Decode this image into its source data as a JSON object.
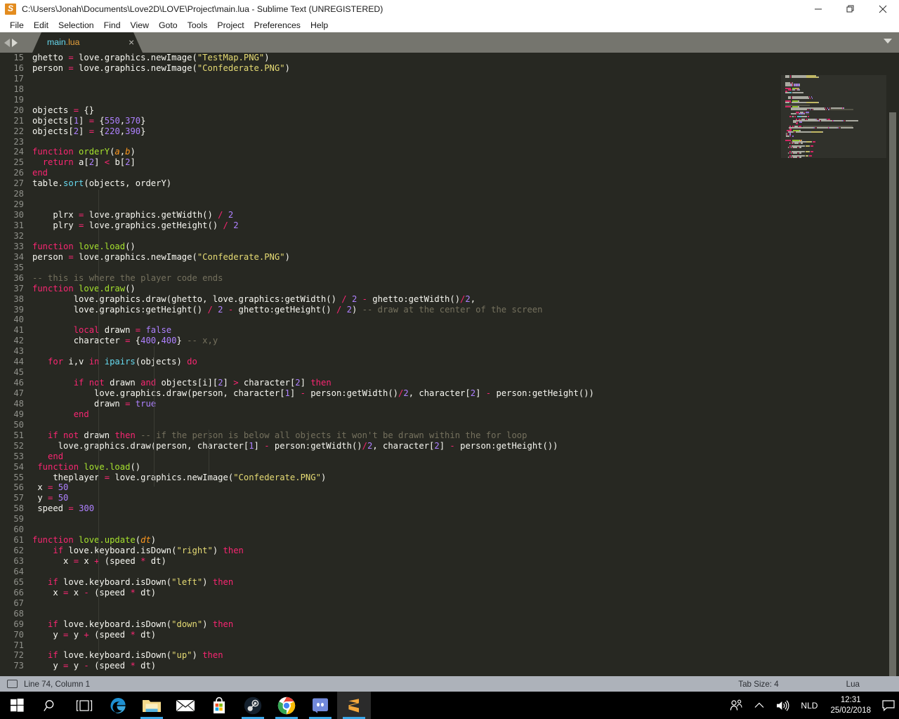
{
  "window": {
    "title": "C:\\Users\\Jonah\\Documents\\Love2D\\LOVE\\Project\\main.lua - Sublime Text (UNREGISTERED)",
    "app_icon": "sublime-text-icon",
    "minimize_label": "—",
    "maximize_label": "❐",
    "close_label": "✕"
  },
  "menubar": {
    "items": [
      {
        "label": "File"
      },
      {
        "label": "Edit"
      },
      {
        "label": "Selection"
      },
      {
        "label": "Find"
      },
      {
        "label": "View"
      },
      {
        "label": "Goto"
      },
      {
        "label": "Tools"
      },
      {
        "label": "Project"
      },
      {
        "label": "Preferences"
      },
      {
        "label": "Help"
      }
    ]
  },
  "tabbar": {
    "tab_name_base": "main",
    "tab_name_ext": ".lua",
    "close_label": "×"
  },
  "editor": {
    "first_line": 15,
    "lines": [
      {
        "n": 15,
        "html": "<span class=\"t-plain\">ghetto </span><span class=\"t-op\">=</span><span class=\"t-plain\"> love.graphics.newImage(</span><span class=\"t-str\">\"TestMap.PNG\"</span><span class=\"t-plain\">)</span>"
      },
      {
        "n": 16,
        "html": "<span class=\"t-plain\">person </span><span class=\"t-op\">=</span><span class=\"t-plain\"> love.graphics.newImage(</span><span class=\"t-str\">\"Confederate.PNG\"</span><span class=\"t-plain\">)</span>"
      },
      {
        "n": 17,
        "html": ""
      },
      {
        "n": 18,
        "html": ""
      },
      {
        "n": 19,
        "html": ""
      },
      {
        "n": 20,
        "html": "<span class=\"t-plain\">objects </span><span class=\"t-op\">=</span><span class=\"t-plain\"> {}</span>"
      },
      {
        "n": 21,
        "html": "<span class=\"t-plain\">objects[</span><span class=\"t-num\">1</span><span class=\"t-plain\">] </span><span class=\"t-op\">=</span><span class=\"t-plain\"> {</span><span class=\"t-num\">550</span><span class=\"t-plain\">,</span><span class=\"t-num\">370</span><span class=\"t-plain\">}</span>"
      },
      {
        "n": 22,
        "html": "<span class=\"t-plain\">objects[</span><span class=\"t-num\">2</span><span class=\"t-plain\">] </span><span class=\"t-op\">=</span><span class=\"t-plain\"> {</span><span class=\"t-num\">220</span><span class=\"t-plain\">,</span><span class=\"t-num\">390</span><span class=\"t-plain\">}</span>"
      },
      {
        "n": 23,
        "html": ""
      },
      {
        "n": 24,
        "html": "<span class=\"t-key\">function</span><span class=\"t-plain\"> </span><span class=\"t-fn\">orderY</span><span class=\"t-plain\">(</span><span class=\"t-par\">a</span><span class=\"t-plain\">,</span><span class=\"t-par\">b</span><span class=\"t-plain\">)</span>"
      },
      {
        "n": 25,
        "html": "<span class=\"t-plain\">  </span><span class=\"t-key\">return</span><span class=\"t-plain\"> a[</span><span class=\"t-num\">2</span><span class=\"t-plain\">] </span><span class=\"t-op\">&lt;</span><span class=\"t-plain\"> b[</span><span class=\"t-num\">2</span><span class=\"t-plain\">]</span>"
      },
      {
        "n": 26,
        "html": "<span class=\"t-key\">end</span>"
      },
      {
        "n": 27,
        "html": "<span class=\"t-plain\">table.</span><span class=\"t-lib\">sort</span><span class=\"t-plain\">(objects, orderY)</span>"
      },
      {
        "n": 28,
        "html": ""
      },
      {
        "n": 29,
        "html": ""
      },
      {
        "n": 30,
        "html": "<span class=\"t-plain\">    plrx </span><span class=\"t-op\">=</span><span class=\"t-plain\"> love.graphics.getWidth() </span><span class=\"t-op\">/</span><span class=\"t-plain\"> </span><span class=\"t-num\">2</span>"
      },
      {
        "n": 31,
        "html": "<span class=\"t-plain\">    plry </span><span class=\"t-op\">=</span><span class=\"t-plain\"> love.graphics.getHeight() </span><span class=\"t-op\">/</span><span class=\"t-plain\"> </span><span class=\"t-num\">2</span>"
      },
      {
        "n": 32,
        "html": ""
      },
      {
        "n": 33,
        "html": "<span class=\"t-key\">function</span><span class=\"t-plain\"> </span><span class=\"t-fn\">love.load</span><span class=\"t-plain\">()</span>"
      },
      {
        "n": 34,
        "html": "<span class=\"t-plain\">person </span><span class=\"t-op\">=</span><span class=\"t-plain\"> love.graphics.newImage(</span><span class=\"t-str\">\"Confederate.PNG\"</span><span class=\"t-plain\">)</span>"
      },
      {
        "n": 35,
        "html": ""
      },
      {
        "n": 36,
        "html": "<span class=\"t-com\">-- this is where the player code ends</span>"
      },
      {
        "n": 37,
        "html": "<span class=\"t-key\">function</span><span class=\"t-plain\"> </span><span class=\"t-fn\">love.draw</span><span class=\"t-plain\">()</span>"
      },
      {
        "n": 38,
        "html": "<span class=\"t-plain\">        love.graphics.draw(ghetto, love.graphics:getWidth() </span><span class=\"t-op\">/</span><span class=\"t-plain\"> </span><span class=\"t-num\">2</span><span class=\"t-plain\"> </span><span class=\"t-op\">-</span><span class=\"t-plain\"> ghetto:getWidth()</span><span class=\"t-op\">/</span><span class=\"t-num\">2</span><span class=\"t-plain\">,</span>"
      },
      {
        "n": 39,
        "html": "<span class=\"t-plain\">        love.graphics:getHeight() </span><span class=\"t-op\">/</span><span class=\"t-plain\"> </span><span class=\"t-num\">2</span><span class=\"t-plain\"> </span><span class=\"t-op\">-</span><span class=\"t-plain\"> ghetto:getHeight() </span><span class=\"t-op\">/</span><span class=\"t-plain\"> </span><span class=\"t-num\">2</span><span class=\"t-plain\">) </span><span class=\"t-com\">-- draw at the center of the screen</span>"
      },
      {
        "n": 40,
        "html": ""
      },
      {
        "n": 41,
        "html": "<span class=\"t-plain\">        </span><span class=\"t-key\">local</span><span class=\"t-plain\"> drawn </span><span class=\"t-op\">=</span><span class=\"t-plain\"> </span><span class=\"t-num\">false</span>"
      },
      {
        "n": 42,
        "html": "<span class=\"t-plain\">        character </span><span class=\"t-op\">=</span><span class=\"t-plain\"> {</span><span class=\"t-num\">400</span><span class=\"t-plain\">,</span><span class=\"t-num\">400</span><span class=\"t-plain\">} </span><span class=\"t-com\">-- x,y</span>"
      },
      {
        "n": 43,
        "html": ""
      },
      {
        "n": 44,
        "html": "<span class=\"t-plain\">   </span><span class=\"t-key\">for</span><span class=\"t-plain\"> i,v </span><span class=\"t-key\">in</span><span class=\"t-plain\"> </span><span class=\"t-lib\">ipairs</span><span class=\"t-plain\">(objects) </span><span class=\"t-key\">do</span>"
      },
      {
        "n": 45,
        "html": ""
      },
      {
        "n": 46,
        "html": "<span class=\"t-plain\">        </span><span class=\"t-key\">if</span><span class=\"t-plain\"> </span><span class=\"t-key\">not</span><span class=\"t-plain\"> drawn </span><span class=\"t-key\">and</span><span class=\"t-plain\"> objects[i][</span><span class=\"t-num\">2</span><span class=\"t-plain\">] </span><span class=\"t-op\">&gt;</span><span class=\"t-plain\"> character[</span><span class=\"t-num\">2</span><span class=\"t-plain\">] </span><span class=\"t-key\">then</span>"
      },
      {
        "n": 47,
        "html": "<span class=\"t-plain\">            love.graphics.draw(person, character[</span><span class=\"t-num\">1</span><span class=\"t-plain\">] </span><span class=\"t-op\">-</span><span class=\"t-plain\"> person:getWidth()</span><span class=\"t-op\">/</span><span class=\"t-num\">2</span><span class=\"t-plain\">, character[</span><span class=\"t-num\">2</span><span class=\"t-plain\">] </span><span class=\"t-op\">-</span><span class=\"t-plain\"> person:getHeight())</span>"
      },
      {
        "n": 48,
        "html": "<span class=\"t-plain\">            drawn </span><span class=\"t-op\">=</span><span class=\"t-plain\"> </span><span class=\"t-num\">true</span>"
      },
      {
        "n": 49,
        "html": "<span class=\"t-plain\">        </span><span class=\"t-key\">end</span>"
      },
      {
        "n": 50,
        "html": ""
      },
      {
        "n": 51,
        "html": "<span class=\"t-plain\">   </span><span class=\"t-key\">if</span><span class=\"t-plain\"> </span><span class=\"t-key\">not</span><span class=\"t-plain\"> drawn </span><span class=\"t-key\">then</span><span class=\"t-plain\"> </span><span class=\"t-com\">-- if the person is below all objects it won't be drawn within the for loop</span>"
      },
      {
        "n": 52,
        "html": "<span class=\"t-plain\">     love.graphics.draw(person, character[</span><span class=\"t-num\">1</span><span class=\"t-plain\">] </span><span class=\"t-op\">-</span><span class=\"t-plain\"> person:getWidth()</span><span class=\"t-op\">/</span><span class=\"t-num\">2</span><span class=\"t-plain\">, character[</span><span class=\"t-num\">2</span><span class=\"t-plain\">] </span><span class=\"t-op\">-</span><span class=\"t-plain\"> person:getHeight())</span>"
      },
      {
        "n": 53,
        "html": "<span class=\"t-plain\">   </span><span class=\"t-key\">end</span>"
      },
      {
        "n": 54,
        "html": "<span class=\"t-plain\"> </span><span class=\"t-key\">function</span><span class=\"t-plain\"> </span><span class=\"t-fn\">love.load</span><span class=\"t-plain\">()</span>"
      },
      {
        "n": 55,
        "html": "<span class=\"t-plain\">    theplayer </span><span class=\"t-op\">=</span><span class=\"t-plain\"> love.graphics.newImage(</span><span class=\"t-str\">\"Confederate.PNG\"</span><span class=\"t-plain\">)</span>"
      },
      {
        "n": 56,
        "html": "<span class=\"t-plain\"> x </span><span class=\"t-op\">=</span><span class=\"t-plain\"> </span><span class=\"t-num\">50</span>"
      },
      {
        "n": 57,
        "html": "<span class=\"t-plain\"> y </span><span class=\"t-op\">=</span><span class=\"t-plain\"> </span><span class=\"t-num\">50</span>"
      },
      {
        "n": 58,
        "html": "<span class=\"t-plain\"> speed </span><span class=\"t-op\">=</span><span class=\"t-plain\"> </span><span class=\"t-num\">300</span>"
      },
      {
        "n": 59,
        "html": ""
      },
      {
        "n": 60,
        "html": ""
      },
      {
        "n": 61,
        "html": "<span class=\"t-key\">function</span><span class=\"t-plain\"> </span><span class=\"t-fn\">love.update</span><span class=\"t-plain\">(</span><span class=\"t-par\">dt</span><span class=\"t-plain\">)</span>"
      },
      {
        "n": 62,
        "html": "<span class=\"t-plain\">    </span><span class=\"t-key\">if</span><span class=\"t-plain\"> love.keyboard.isDown(</span><span class=\"t-str\">\"right\"</span><span class=\"t-plain\">) </span><span class=\"t-key\">then</span>"
      },
      {
        "n": 63,
        "html": "<span class=\"t-plain\">      x </span><span class=\"t-op\">=</span><span class=\"t-plain\"> x </span><span class=\"t-op\">+</span><span class=\"t-plain\"> (speed </span><span class=\"t-op\">*</span><span class=\"t-plain\"> dt)</span>"
      },
      {
        "n": 64,
        "html": ""
      },
      {
        "n": 65,
        "html": "<span class=\"t-plain\">   </span><span class=\"t-key\">if</span><span class=\"t-plain\"> love.keyboard.isDown(</span><span class=\"t-str\">\"left\"</span><span class=\"t-plain\">) </span><span class=\"t-key\">then</span>"
      },
      {
        "n": 66,
        "html": "<span class=\"t-plain\">    x </span><span class=\"t-op\">=</span><span class=\"t-plain\"> x </span><span class=\"t-op\">-</span><span class=\"t-plain\"> (speed </span><span class=\"t-op\">*</span><span class=\"t-plain\"> dt)</span>"
      },
      {
        "n": 67,
        "html": ""
      },
      {
        "n": 68,
        "html": ""
      },
      {
        "n": 69,
        "html": "<span class=\"t-plain\">   </span><span class=\"t-key\">if</span><span class=\"t-plain\"> love.keyboard.isDown(</span><span class=\"t-str\">\"down\"</span><span class=\"t-plain\">) </span><span class=\"t-key\">then</span>"
      },
      {
        "n": 70,
        "html": "<span class=\"t-plain\">    y </span><span class=\"t-op\">=</span><span class=\"t-plain\"> y </span><span class=\"t-op\">+</span><span class=\"t-plain\"> (speed </span><span class=\"t-op\">*</span><span class=\"t-plain\"> dt)</span>"
      },
      {
        "n": 71,
        "html": ""
      },
      {
        "n": 72,
        "html": "<span class=\"t-plain\">   </span><span class=\"t-key\">if</span><span class=\"t-plain\"> love.keyboard.isDown(</span><span class=\"t-str\">\"up\"</span><span class=\"t-plain\">) </span><span class=\"t-key\">then</span>"
      },
      {
        "n": 73,
        "html": "<span class=\"t-plain\">    y </span><span class=\"t-op\">=</span><span class=\"t-plain\"> y </span><span class=\"t-op\">-</span><span class=\"t-plain\"> (speed </span><span class=\"t-op\">*</span><span class=\"t-plain\"> dt)</span>"
      }
    ]
  },
  "statusbar": {
    "cursor": "Line 74, Column 1",
    "tab_size": "Tab Size: 4",
    "syntax": "Lua"
  },
  "taskbar": {
    "items": [
      {
        "name": "start-button",
        "icon": "windows-logo-icon",
        "active": false,
        "running": false
      },
      {
        "name": "search-button",
        "icon": "search-icon",
        "active": false,
        "running": false
      },
      {
        "name": "task-view-button",
        "icon": "task-view-icon",
        "active": false,
        "running": false
      },
      {
        "name": "edge-button",
        "icon": "edge-icon",
        "active": false,
        "running": false
      },
      {
        "name": "file-explorer-button",
        "icon": "folder-icon",
        "active": false,
        "running": true
      },
      {
        "name": "mail-button",
        "icon": "mail-icon",
        "active": false,
        "running": false
      },
      {
        "name": "store-button",
        "icon": "store-icon",
        "active": false,
        "running": false
      },
      {
        "name": "steam-button",
        "icon": "steam-icon",
        "active": false,
        "running": true
      },
      {
        "name": "chrome-button",
        "icon": "chrome-icon",
        "active": false,
        "running": true
      },
      {
        "name": "discord-button",
        "icon": "discord-icon",
        "active": false,
        "running": true
      },
      {
        "name": "sublime-text-button",
        "icon": "sublime-text-icon",
        "active": true,
        "running": true
      }
    ],
    "tray": {
      "people_icon": "people-icon",
      "chevron_icon": "chevron-up-icon",
      "volume_icon": "volume-icon",
      "language": "NLD",
      "time": "12:31",
      "date": "25/02/2018",
      "notification_icon": "notification-icon"
    }
  },
  "colors": {
    "editor_bg": "#272822",
    "keyword": "#f92672",
    "string": "#e6db74",
    "number": "#ae81ff",
    "comment": "#75715e",
    "function": "#a6e22e",
    "plain": "#f8f8f2",
    "accent_blue": "#3ba7e8",
    "statusbar_bg": "#adb2ba",
    "tabbar_bg": "#75756e"
  }
}
